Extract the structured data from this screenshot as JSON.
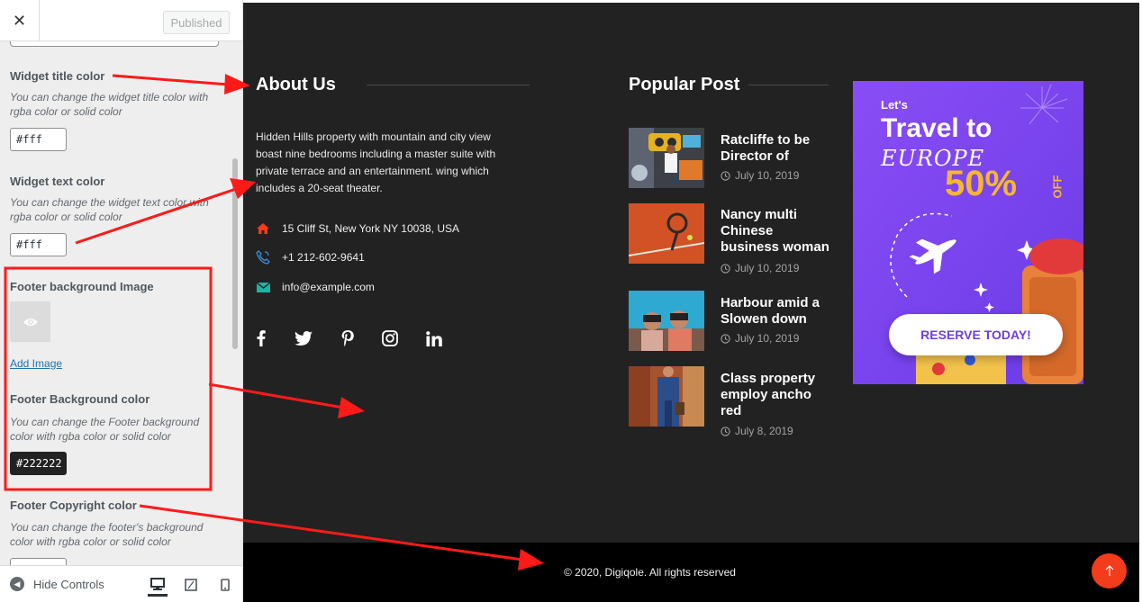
{
  "customizer": {
    "close_icon": "close-icon",
    "publish_label": "Published",
    "widget_title_color": {
      "title": "Widget title color",
      "description": "You can change the widget title color with rgba color or solid color",
      "value": "#fff"
    },
    "widget_text_color": {
      "title": "Widget text color",
      "description": "You can change the widget text color with rgba color or solid color",
      "value": "#fff"
    },
    "footer_bg_image": {
      "title": "Footer background Image",
      "add_label": "Add Image"
    },
    "footer_bg_color": {
      "title": "Footer Background color",
      "description": "You can change the Footer background color with rgba color or solid color",
      "value": "#222222"
    },
    "footer_copyright_color": {
      "title": "Footer Copyright color",
      "description": "You can change the footer's background color with rgba color or solid color"
    },
    "hide_controls_label": "Hide Controls"
  },
  "footer": {
    "about": {
      "title": "About Us",
      "text": "Hidden Hills property with mountain and city view boast nine bedrooms including a master suite with private terrace and an entertainment. wing which includes a 20-seat theater.",
      "address": "15 Cliff St, New York NY 10038, USA",
      "phone": "+1 212-602-9641",
      "email": "info@example.com"
    },
    "social": [
      "facebook-icon",
      "twitter-icon",
      "pinterest-icon",
      "instagram-icon",
      "linkedin-icon"
    ],
    "popular": {
      "title": "Popular Post",
      "posts": [
        {
          "title": "Ratcliffe to be Director of",
          "date": "July 10, 2019"
        },
        {
          "title": "Nancy multi Chinese business woman",
          "date": "July 10, 2019"
        },
        {
          "title": "Harbour amid a Slowen down",
          "date": "July 10, 2019"
        },
        {
          "title": "Class property employ ancho red",
          "date": "July 8, 2019"
        }
      ]
    },
    "ad": {
      "lets": "Let's",
      "travel": "Travel to",
      "europe": "EUROPE",
      "discount": "50%",
      "off": "OFF",
      "cta": "RESERVE TODAY!"
    },
    "copyright": "© 2020, Digiqole. All rights reserved"
  },
  "colors": {
    "footer_bg": "#222222",
    "copyright_bg": "#000000",
    "accent": "#f23c1b",
    "annotation": "#ff0000"
  }
}
